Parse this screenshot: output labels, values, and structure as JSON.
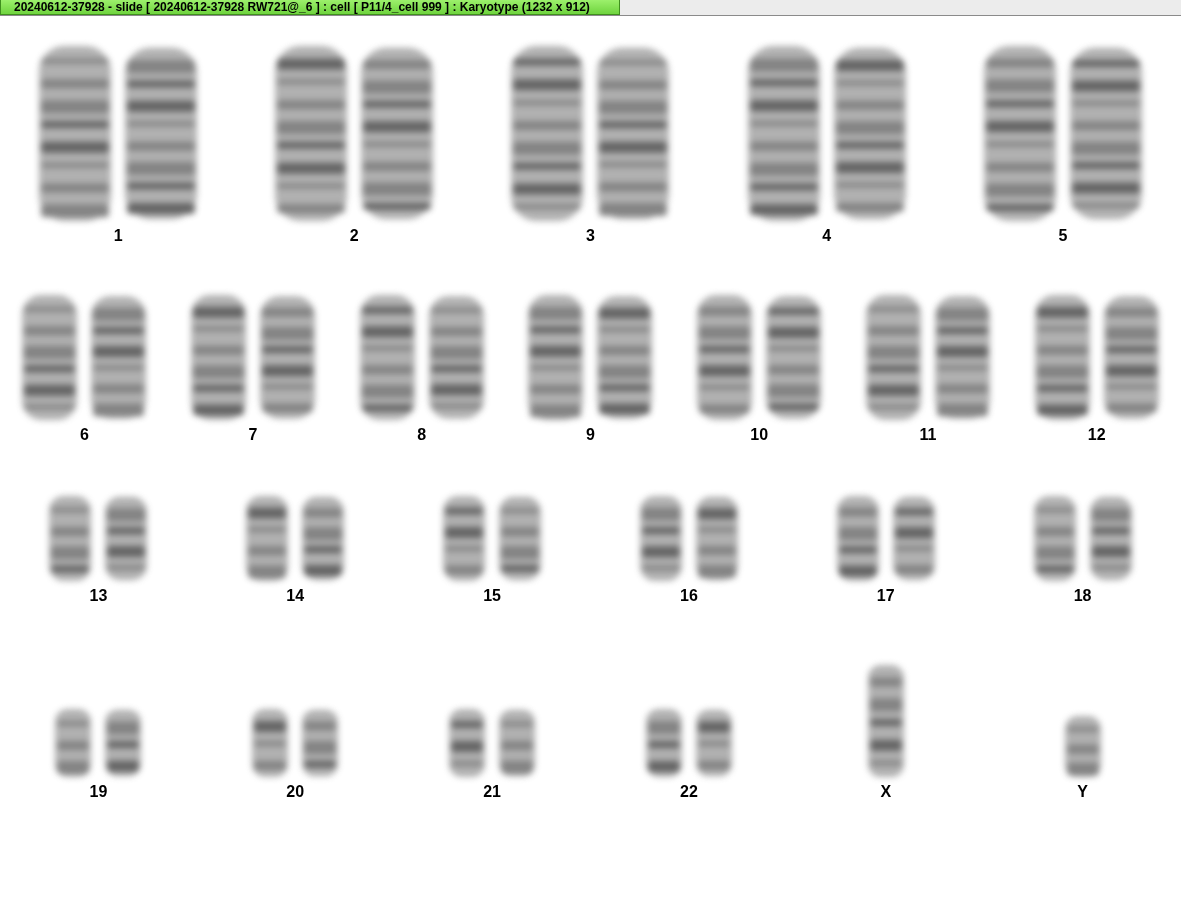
{
  "window": {
    "title": "20240612-37928 - slide [ 20240612-37928 RW721@_6 ] : cell [ P11/4_cell 999 ] : Karyotype  (1232 x 912)"
  },
  "karyotype": {
    "rows": [
      {
        "items": [
          {
            "label": "1",
            "kind": "pair"
          },
          {
            "label": "2",
            "kind": "pair"
          },
          {
            "label": "3",
            "kind": "pair"
          },
          {
            "label": "4",
            "kind": "pair"
          },
          {
            "label": "5",
            "kind": "pair"
          }
        ]
      },
      {
        "items": [
          {
            "label": "6",
            "kind": "pair"
          },
          {
            "label": "7",
            "kind": "pair"
          },
          {
            "label": "8",
            "kind": "pair"
          },
          {
            "label": "9",
            "kind": "pair"
          },
          {
            "label": "10",
            "kind": "pair"
          },
          {
            "label": "11",
            "kind": "pair"
          },
          {
            "label": "12",
            "kind": "pair"
          }
        ]
      },
      {
        "items": [
          {
            "label": "13",
            "kind": "pair"
          },
          {
            "label": "14",
            "kind": "pair"
          },
          {
            "label": "15",
            "kind": "pair"
          },
          {
            "label": "16",
            "kind": "pair"
          },
          {
            "label": "17",
            "kind": "pair"
          },
          {
            "label": "18",
            "kind": "pair"
          }
        ]
      },
      {
        "items": [
          {
            "label": "19",
            "kind": "pair"
          },
          {
            "label": "20",
            "kind": "pair"
          },
          {
            "label": "21",
            "kind": "pair"
          },
          {
            "label": "22",
            "kind": "pair"
          },
          {
            "label": "X",
            "kind": "single"
          },
          {
            "label": "Y",
            "kind": "single"
          }
        ]
      }
    ]
  }
}
